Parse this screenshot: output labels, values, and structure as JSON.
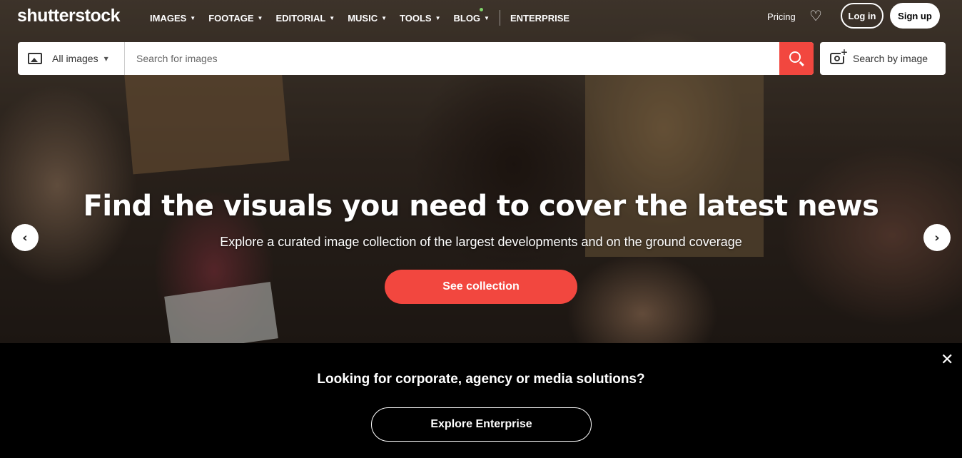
{
  "header": {
    "logo": "shutterstock",
    "nav": [
      {
        "label": "IMAGES",
        "has_menu": true
      },
      {
        "label": "FOOTAGE",
        "has_menu": true
      },
      {
        "label": "EDITORIAL",
        "has_menu": true
      },
      {
        "label": "MUSIC",
        "has_menu": true
      },
      {
        "label": "TOOLS",
        "has_menu": true
      },
      {
        "label": "BLOG",
        "has_menu": true
      }
    ],
    "enterprise": "ENTERPRISE",
    "pricing": "Pricing",
    "login": "Log in",
    "signup": "Sign up"
  },
  "search": {
    "type_label": "All images",
    "placeholder": "Search for images",
    "value": "",
    "by_image": "Search by image"
  },
  "hero": {
    "headline": "Find the visuals you need to cover the latest news",
    "subline": "Explore a curated image collection of the largest developments and on the ground coverage",
    "cta": "See collection"
  },
  "banner": {
    "title": "Looking for corporate, agency or media solutions?",
    "button": "Explore Enterprise"
  },
  "colors": {
    "accent": "#f2473f",
    "banner_bg": "#000000"
  },
  "icons": [
    "heart-icon",
    "image-icon",
    "search-icon",
    "camera-search-icon",
    "chevron-left-icon",
    "chevron-right-icon",
    "close-icon"
  ]
}
